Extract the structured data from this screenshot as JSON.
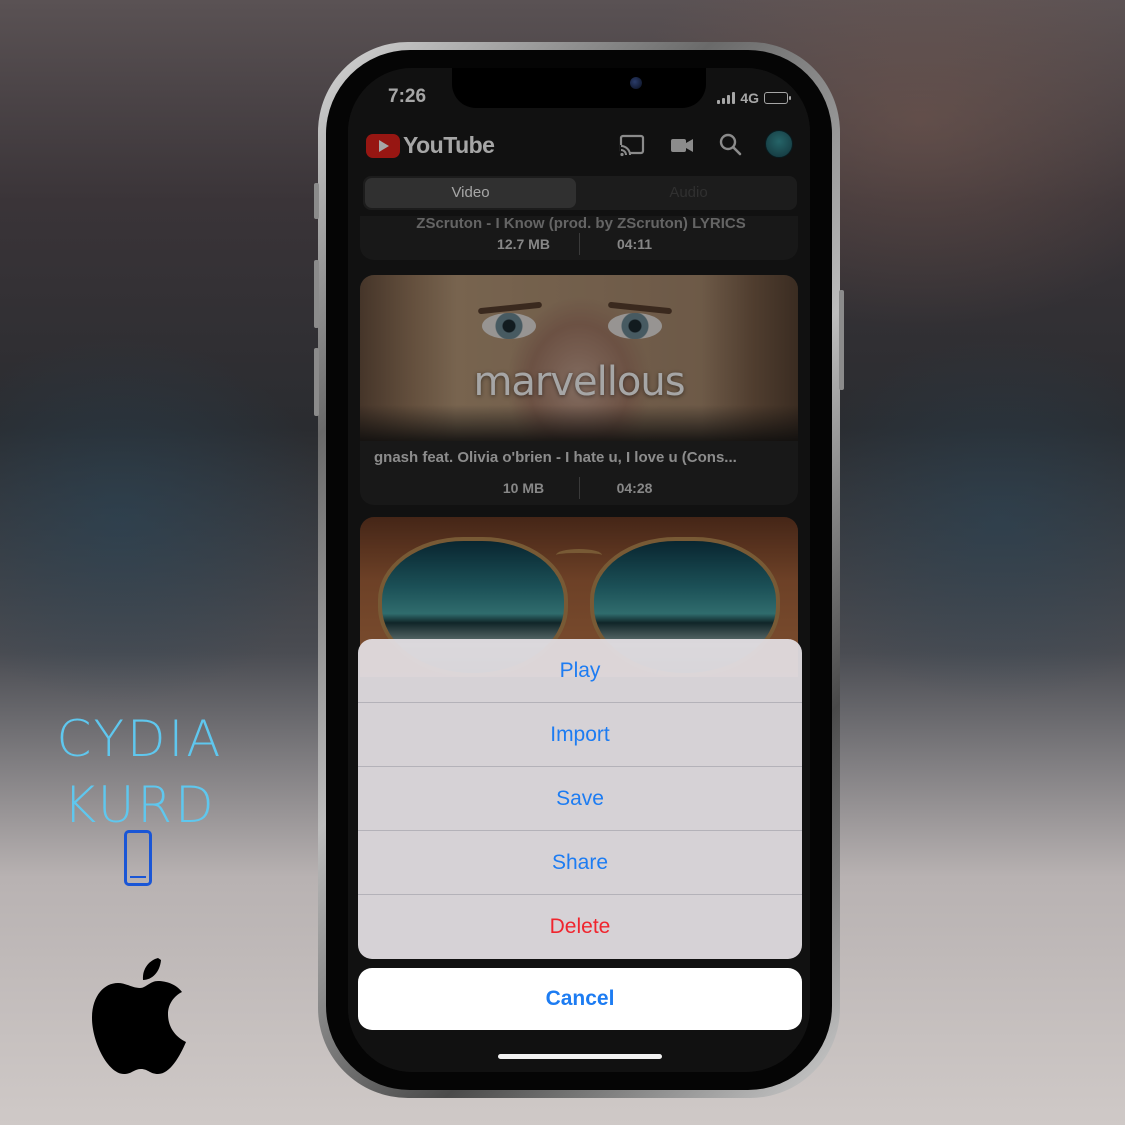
{
  "watermark": {
    "line1": "CYDIA",
    "line2": "KURD",
    "phone_icon": "smartphone-icon",
    "logo_icon": "apple-logo-icon"
  },
  "status_bar": {
    "time": "7:26",
    "network": "4G",
    "icons": [
      "signal-bars-icon",
      "battery-icon"
    ]
  },
  "header": {
    "app_name": "YouTube",
    "icons": [
      "cast-icon",
      "video-camera-icon",
      "search-icon",
      "account-avatar-icon"
    ]
  },
  "tabs": [
    {
      "label": "Video",
      "selected": true
    },
    {
      "label": "Audio",
      "selected": false
    }
  ],
  "videos": [
    {
      "title": "ZScruton - I Know (prod. by ZScruton) LYRICS",
      "size": "12.7 MB",
      "duration": "04:11"
    },
    {
      "thumb_text": "marvellous",
      "title": "gnash feat. Olivia o'brien - I hate u, I love u  (Cons...",
      "size": "10 MB",
      "duration": "04:28"
    },
    {
      "thumb_text": "",
      "title": "",
      "size": "",
      "duration": ""
    }
  ],
  "action_sheet": {
    "actions": [
      {
        "label": "Play",
        "style": "default"
      },
      {
        "label": "Import",
        "style": "default"
      },
      {
        "label": "Save",
        "style": "default"
      },
      {
        "label": "Share",
        "style": "default"
      },
      {
        "label": "Delete",
        "style": "destructive"
      }
    ],
    "cancel_label": "Cancel"
  },
  "colors": {
    "accent_blue": "#1d7cf2",
    "destructive_red": "#f0252e",
    "youtube_red": "#e8221c",
    "watermark_cyan": "#5fc7ee"
  }
}
